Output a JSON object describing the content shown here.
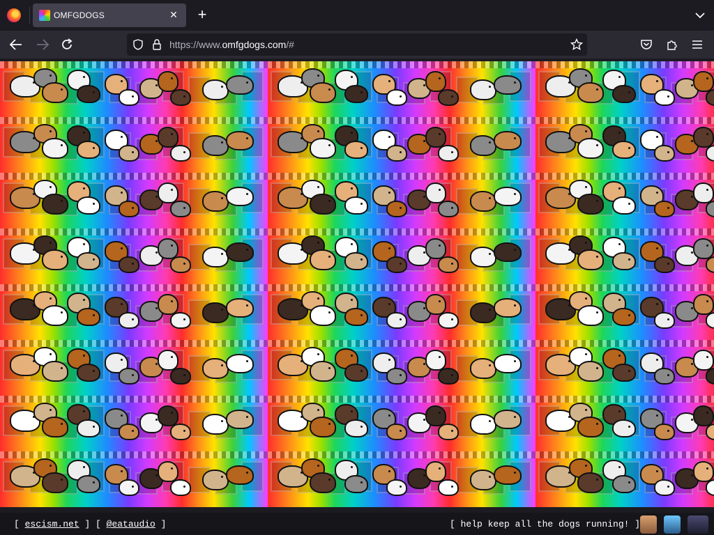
{
  "browser": {
    "tab_title": "OMFGDOGS",
    "url_prefix": "https://www.",
    "url_domain": "omfgdogs.com",
    "url_suffix": "/#"
  },
  "page": {
    "tile_rows": 8,
    "tile_cols": 3
  },
  "footer": {
    "link1_open": "[ ",
    "link1": "escism.net",
    "sep": " ] [ ",
    "link2": "@eataudio",
    "link2_close": " ]",
    "right_text": "[ help keep all the dogs running! ]"
  },
  "icons": {
    "back": "back-arrow-icon",
    "forward": "forward-arrow-icon",
    "reload": "reload-icon",
    "tracking": "shield-icon",
    "lock": "lock-icon",
    "bookmark": "star-icon",
    "pocket": "pocket-icon",
    "extensions": "puzzle-icon",
    "menu": "hamburger-menu-icon"
  }
}
